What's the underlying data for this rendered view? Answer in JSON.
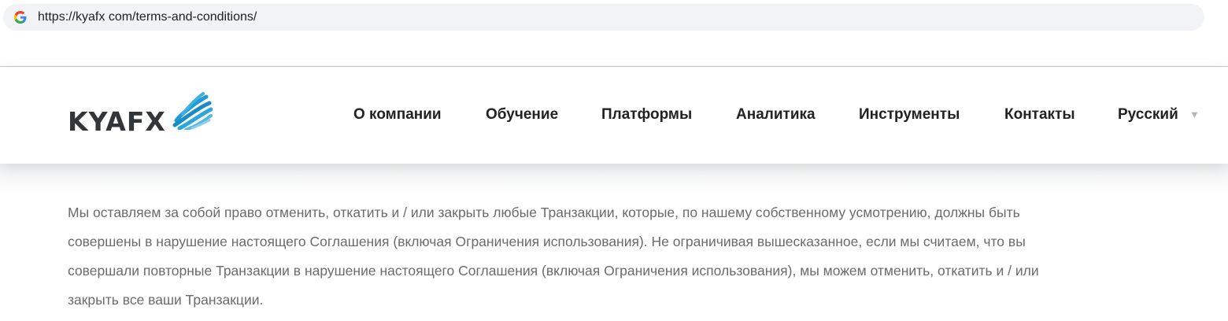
{
  "browser": {
    "url": "https://kyafx com/terms-and-conditions/",
    "site_icon": "google-g-icon"
  },
  "header": {
    "logo_text": "KYAFX",
    "logo_icon": "globe-swirl-icon",
    "nav": [
      "О компании",
      "Обучение",
      "Платформы",
      "Аналитика",
      "Инструменты",
      "Контакты",
      "Русский"
    ],
    "language_dropdown_icon": "triangle-down-icon"
  },
  "content": {
    "paragraph_lines": [
      "Мы оставляем за собой право отменить, откатить и / или закрыть любые Транзакции, которые, по нашему собственному усмотрению, должны быть",
      "совершены в нарушение настоящего Соглашения (включая Ограничения использования). Не ограничивая вышесказанное, если мы считаем, что вы",
      "совершали повторные Транзакции в нарушение настоящего Соглашения (включая Ограничения использования), мы можем отменить, откатить и / или",
      "закрыть все ваши Транзакции."
    ]
  },
  "colors": {
    "logo_blue": "#1e9bd7",
    "logo_dark": "#333638",
    "body_text": "#6b6b6b"
  }
}
